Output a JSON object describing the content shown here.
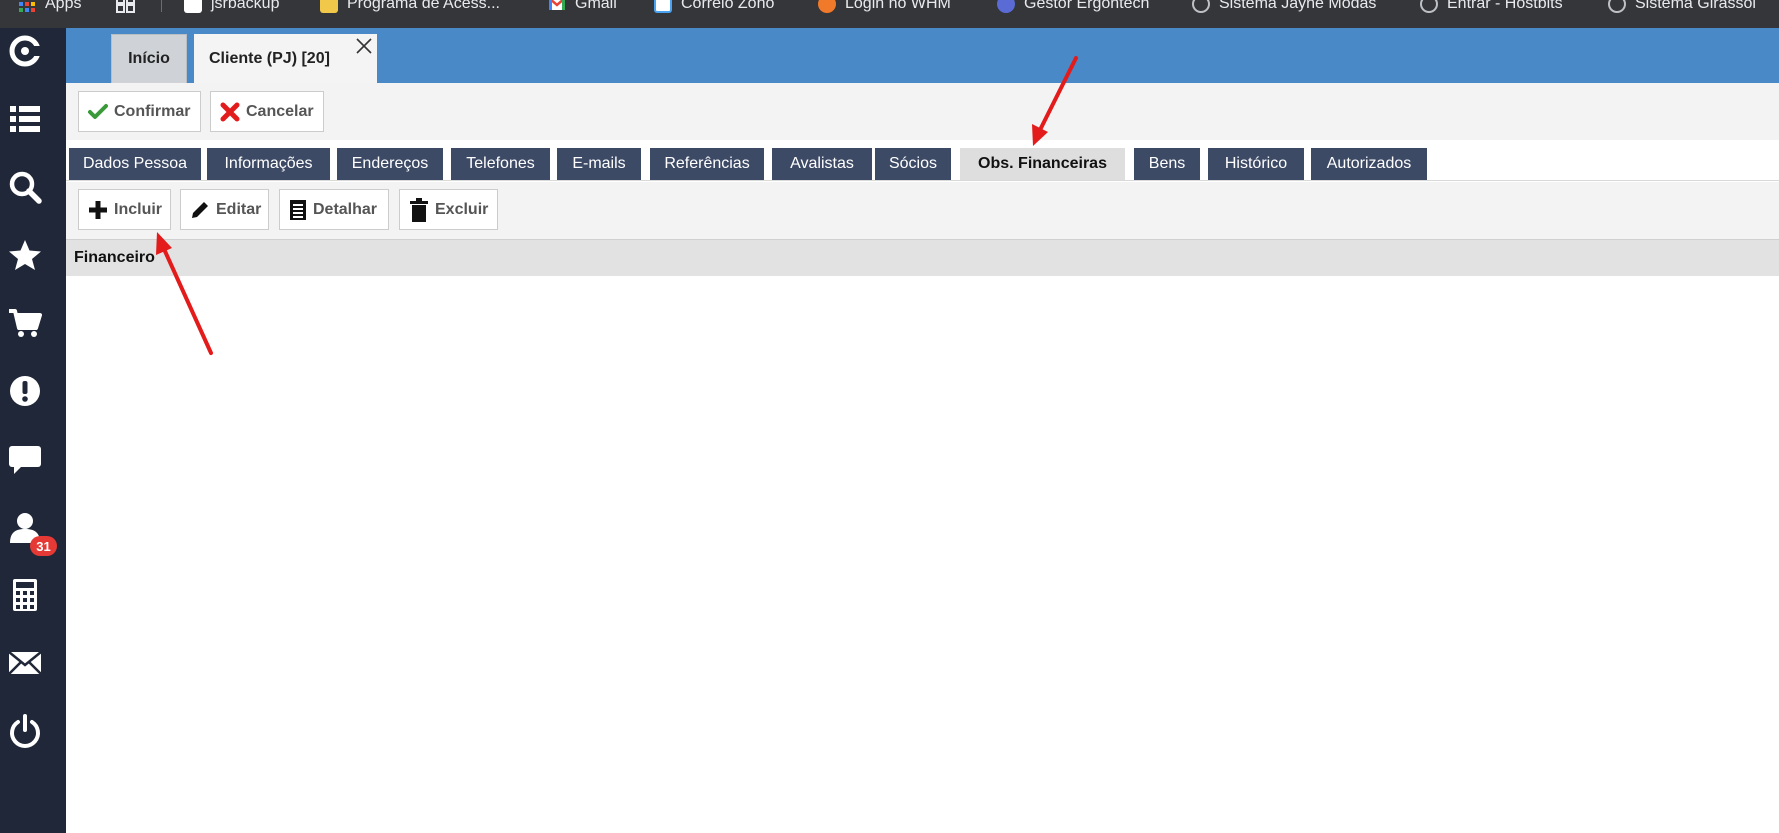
{
  "bookmarks": [
    {
      "label": "Apps",
      "icon": "apps-grid-icon"
    },
    {
      "label": "",
      "icon": "reading-list-icon"
    },
    {
      "label": "jsrbackup",
      "icon": "page-icon"
    },
    {
      "label": "Programa de Acess...",
      "icon": "folder-icon"
    },
    {
      "label": "Gmail",
      "icon": "gmail-icon"
    },
    {
      "label": "Correio Zoho",
      "icon": "zoho-mail-icon"
    },
    {
      "label": "Login no WHM",
      "icon": "whm-icon"
    },
    {
      "label": "Gestor Ergontech",
      "icon": "globe-icon"
    },
    {
      "label": "Sistema Jayne Modas",
      "icon": "globe-icon"
    },
    {
      "label": "Entrar - Hostbits",
      "icon": "globe-icon"
    },
    {
      "label": "Sistema Girassol",
      "icon": "globe-icon"
    }
  ],
  "sidenav": {
    "items": [
      "logo-icon",
      "list-icon",
      "search-icon",
      "star-icon",
      "cart-icon",
      "alert-icon",
      "chat-icon",
      "user-icon",
      "calculator-icon",
      "mail-icon",
      "power-icon"
    ],
    "user_badge": "31"
  },
  "page_tabs": {
    "inicio": "Início",
    "cliente": "Cliente (PJ) [20]"
  },
  "toolbar": {
    "confirm_label": "Confirmar",
    "cancel_label": "Cancelar"
  },
  "subtabs": [
    {
      "label": "Dados Pessoa",
      "active": false
    },
    {
      "label": "Informações",
      "active": false
    },
    {
      "label": "Endereços",
      "active": false
    },
    {
      "label": "Telefones",
      "active": false
    },
    {
      "label": "E-mails",
      "active": false
    },
    {
      "label": "Referências",
      "active": false
    },
    {
      "label": "Avalistas",
      "active": false
    },
    {
      "label": "Sócios",
      "active": false
    },
    {
      "label": "Obs. Financeiras",
      "active": true
    },
    {
      "label": "Bens",
      "active": false
    },
    {
      "label": "Histórico",
      "active": false
    },
    {
      "label": "Autorizados",
      "active": false
    }
  ],
  "actions": {
    "include_label": "Incluir",
    "edit_label": "Editar",
    "detail_label": "Detalhar",
    "delete_label": "Excluir"
  },
  "section": {
    "title": "Financeiro"
  },
  "colors": {
    "sidenav_bg": "#1f2738",
    "top_band": "#4a89c8",
    "tab_bg": "#3d4a66",
    "tab_active_bg": "#dedede",
    "arrow": "#e31b1b",
    "confirm_green": "#3a9a3a",
    "cancel_red": "#e21c1c"
  }
}
